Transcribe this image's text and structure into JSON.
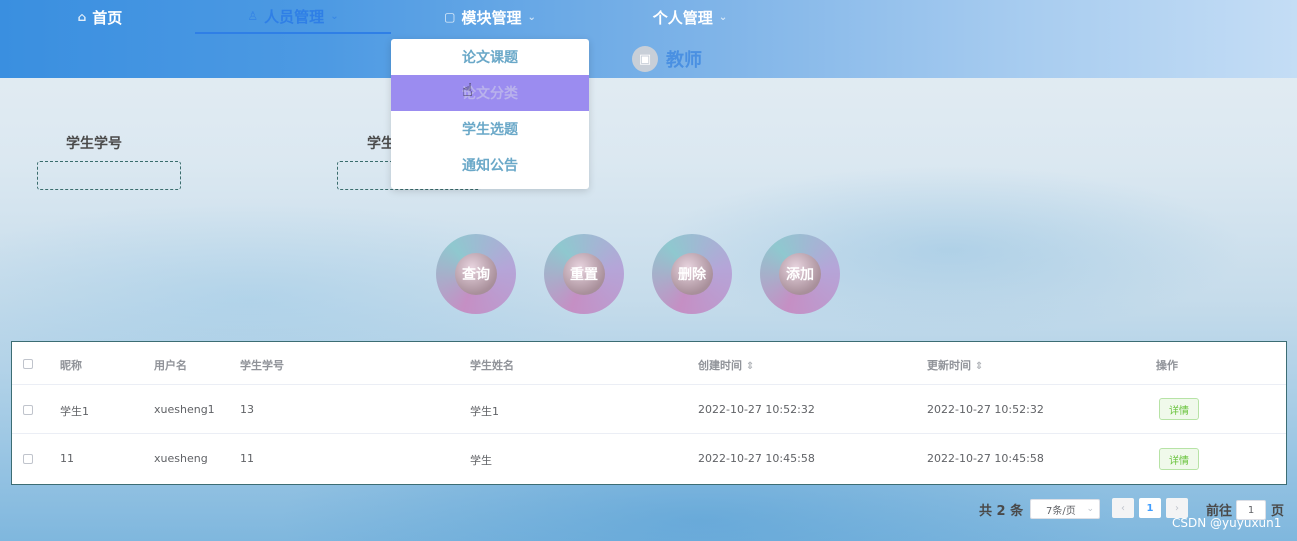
{
  "nav": {
    "items": [
      {
        "label": "首页",
        "icon": "home-icon",
        "icon_glyph": "⌂",
        "caret": ""
      },
      {
        "label": "人员管理",
        "icon": "user-icon",
        "icon_glyph": "♙",
        "caret": "⌄"
      },
      {
        "label": "模块管理",
        "icon": "module-icon",
        "icon_glyph": "▢",
        "caret": "⌄"
      },
      {
        "label": "个人管理",
        "icon": "",
        "icon_glyph": "",
        "caret": "⌄"
      }
    ],
    "role": "教师",
    "role_icon": "image-icon"
  },
  "dropdown": {
    "items": [
      "论文课题",
      "论文分类",
      "学生选题",
      "通知公告"
    ],
    "hover_index": 1
  },
  "search": {
    "fields": [
      {
        "label": "学生学号",
        "value": ""
      },
      {
        "label": "学生",
        "value": ""
      }
    ]
  },
  "actions": [
    "查询",
    "重置",
    "删除",
    "添加"
  ],
  "table": {
    "headers": [
      "昵称",
      "用户名",
      "学生学号",
      "学生姓名",
      "创建时间",
      "更新时间",
      "操作"
    ],
    "rows": [
      [
        "学生1",
        "xuesheng1",
        "13",
        "学生1",
        "2022-10-27 10:52:32",
        "2022-10-27 10:52:32",
        "详情"
      ],
      [
        "11",
        "xuesheng",
        "11",
        "学生",
        "2022-10-27 10:45:58",
        "2022-10-27 10:45:58",
        "详情"
      ]
    ]
  },
  "pagination": {
    "total": "共 2 条",
    "page_size": "7条/页",
    "current_page": "1",
    "goto_label": "前往",
    "goto_value": "1",
    "page_suffix": "页"
  },
  "watermark": "CSDN @yuyuxun1",
  "colors": {
    "accent": "#409eff",
    "hover": "#9b8cf0",
    "detail": "#67c23a"
  }
}
